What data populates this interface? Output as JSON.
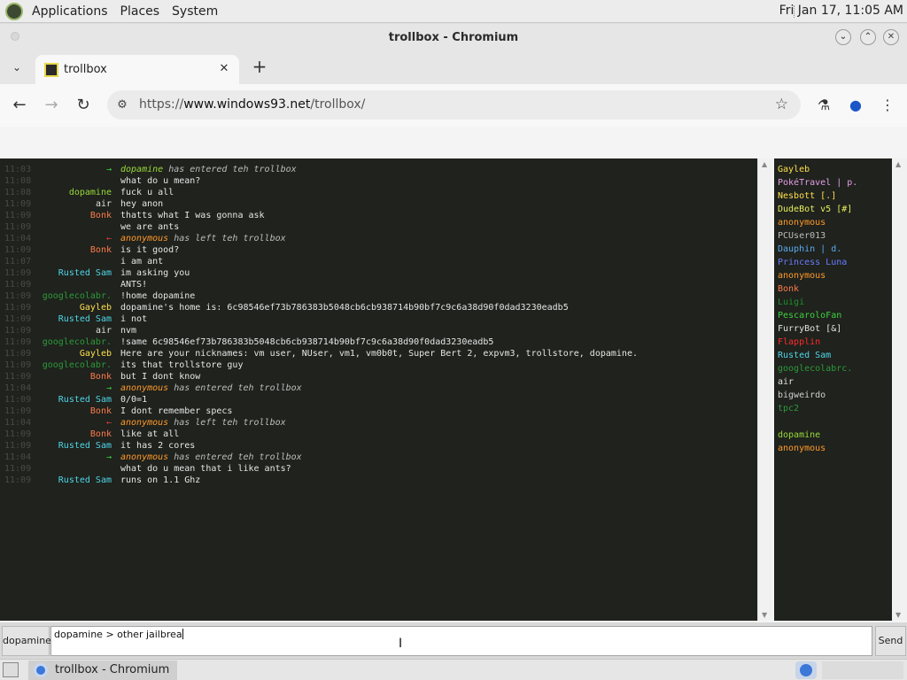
{
  "panel": {
    "applications": "Applications",
    "places": "Places",
    "system": "System",
    "clock": "Fri Jan 17, 11:05 AM"
  },
  "window": {
    "title": "trollbox - Chromium"
  },
  "tab": {
    "label": "trollbox"
  },
  "toolbar": {
    "url_scheme": "https://",
    "url_host": "www.windows93.net",
    "url_path": "/trollbox/"
  },
  "chat": {
    "messages": [
      {
        "time": "11:03",
        "nick": "→",
        "nick_color": "#3ed13e",
        "who": "dopamine",
        "who_color": "#9ad93a",
        "text": " has entered teh trollbox",
        "system": true
      },
      {
        "time": "11:08",
        "nick": "",
        "nick_color": "#ffffff",
        "who": "",
        "who_color": "",
        "text": "what do u mean?",
        "system": false
      },
      {
        "time": "11:08",
        "nick": "dopamine",
        "nick_color": "#9ad93a",
        "who": "",
        "who_color": "",
        "text": "fuck u all",
        "system": false
      },
      {
        "time": "11:09",
        "nick": "air",
        "nick_color": "#e0e0e0",
        "who": "",
        "who_color": "",
        "text": "hey anon",
        "system": false
      },
      {
        "time": "11:09",
        "nick": "Bonk",
        "nick_color": "#ff7b4a",
        "who": "",
        "who_color": "",
        "text": "thatts what I was gonna ask",
        "system": false
      },
      {
        "time": "11:09",
        "nick": "",
        "nick_color": "#ffffff",
        "who": "",
        "who_color": "",
        "text": "we are ants",
        "system": false
      },
      {
        "time": "11:04",
        "nick": "←",
        "nick_color": "#e23b3b",
        "who": "anonymous",
        "who_color": "#ff9a2a",
        "text": " has left teh trollbox",
        "system": true
      },
      {
        "time": "11:09",
        "nick": "Bonk",
        "nick_color": "#ff7b4a",
        "who": "",
        "who_color": "",
        "text": "is it good?",
        "system": false
      },
      {
        "time": "11:07",
        "nick": "",
        "nick_color": "#ffffff",
        "who": "",
        "who_color": "",
        "text": "i am ant",
        "system": false
      },
      {
        "time": "11:09",
        "nick": "Rusted Sam",
        "nick_color": "#4fd6e8",
        "who": "",
        "who_color": "",
        "text": "im asking you",
        "system": false
      },
      {
        "time": "11:09",
        "nick": "",
        "nick_color": "#ffffff",
        "who": "",
        "who_color": "",
        "text": "ANTS!",
        "system": false
      },
      {
        "time": "11:09",
        "nick": "googlecolabr.",
        "nick_color": "#2d9a3a",
        "who": "",
        "who_color": "",
        "text": "!home dopamine",
        "system": false
      },
      {
        "time": "11:09",
        "nick": "Gayleb",
        "nick_color": "#ffe04a",
        "who": "",
        "who_color": "",
        "text": "dopamine's home is: 6c98546ef73b786383b5048cb6cb938714b90bf7c9c6a38d90f0dad3230eadb5",
        "system": false
      },
      {
        "time": "11:09",
        "nick": "Rusted Sam",
        "nick_color": "#4fd6e8",
        "who": "",
        "who_color": "",
        "text": "i not",
        "system": false
      },
      {
        "time": "11:09",
        "nick": "air",
        "nick_color": "#e0e0e0",
        "who": "",
        "who_color": "",
        "text": "nvm",
        "system": false
      },
      {
        "time": "11:09",
        "nick": "googlecolabr.",
        "nick_color": "#2d9a3a",
        "who": "",
        "who_color": "",
        "text": "!same 6c98546ef73b786383b5048cb6cb938714b90bf7c9c6a38d90f0dad3230eadb5",
        "system": false
      },
      {
        "time": "11:09",
        "nick": "Gayleb",
        "nick_color": "#ffe04a",
        "who": "",
        "who_color": "",
        "text": "Here are your nicknames: vm user, NUser, vm1, vm0b0t, Super Bert 2, expvm3, trollstore, dopamine.",
        "system": false
      },
      {
        "time": "11:09",
        "nick": "googlecolabr.",
        "nick_color": "#2d9a3a",
        "who": "",
        "who_color": "",
        "text": "its that trollstore guy",
        "system": false
      },
      {
        "time": "11:09",
        "nick": "Bonk",
        "nick_color": "#ff7b4a",
        "who": "",
        "who_color": "",
        "text": "but I dont know",
        "system": false
      },
      {
        "time": "11:04",
        "nick": "→",
        "nick_color": "#3ed13e",
        "who": "anonymous",
        "who_color": "#ff9a2a",
        "text": " has entered teh trollbox",
        "system": true
      },
      {
        "time": "11:09",
        "nick": "Rusted Sam",
        "nick_color": "#4fd6e8",
        "who": "",
        "who_color": "",
        "text": "0/0=1",
        "system": false
      },
      {
        "time": "11:09",
        "nick": "Bonk",
        "nick_color": "#ff7b4a",
        "who": "",
        "who_color": "",
        "text": "I dont remember specs",
        "system": false
      },
      {
        "time": "11:04",
        "nick": "←",
        "nick_color": "#e23b3b",
        "who": "anonymous",
        "who_color": "#ff9a2a",
        "text": " has left teh trollbox",
        "system": true
      },
      {
        "time": "11:09",
        "nick": "Bonk",
        "nick_color": "#ff7b4a",
        "who": "",
        "who_color": "",
        "text": "like at all",
        "system": false
      },
      {
        "time": "11:09",
        "nick": "Rusted Sam",
        "nick_color": "#4fd6e8",
        "who": "",
        "who_color": "",
        "text": "it has 2 cores",
        "system": false
      },
      {
        "time": "11:04",
        "nick": "→",
        "nick_color": "#3ed13e",
        "who": "anonymous",
        "who_color": "#ff9a2a",
        "text": " has entered teh trollbox",
        "system": true
      },
      {
        "time": "11:09",
        "nick": "",
        "nick_color": "#ffffff",
        "who": "",
        "who_color": "",
        "text": "what do u mean that i like ants?",
        "system": false
      },
      {
        "time": "11:09",
        "nick": "Rusted Sam",
        "nick_color": "#4fd6e8",
        "who": "",
        "who_color": "",
        "text": "runs on 1.1 Ghz",
        "system": false
      }
    ]
  },
  "users": [
    {
      "name": "Gayleb",
      "color": "#ffe04a"
    },
    {
      "name": "PokéTravel | p.",
      "color": "#e79ee8"
    },
    {
      "name": "Nesbott [.]",
      "color": "#ffe04a"
    },
    {
      "name": "DudeBot v5 [#]",
      "color": "#e8ef5a"
    },
    {
      "name": "anonymous",
      "color": "#ff9a2a"
    },
    {
      "name": "PCUser013",
      "color": "#bdbdbd"
    },
    {
      "name": "Dauphin | d.",
      "color": "#5aaaf0"
    },
    {
      "name": "Princess Luna",
      "color": "#6a7cff"
    },
    {
      "name": "anonymous",
      "color": "#ff9a2a"
    },
    {
      "name": "Bonk",
      "color": "#ff7b4a"
    },
    {
      "name": "Luigi",
      "color": "#1f8f2a"
    },
    {
      "name": "PescaroloFan",
      "color": "#3ed13e"
    },
    {
      "name": "FurryBot [&]",
      "color": "#e0e0e0"
    },
    {
      "name": "Flapplin",
      "color": "#ff2a2a"
    },
    {
      "name": "Rusted Sam",
      "color": "#4fd6e8"
    },
    {
      "name": "googlecolabrc.",
      "color": "#2d9a3a"
    },
    {
      "name": "air",
      "color": "#e0e0e0"
    },
    {
      "name": "bigweirdo",
      "color": "#d0d0d0"
    },
    {
      "name": "tpc2",
      "color": "#2d9a3a"
    },
    {
      "name": "",
      "color": "#e0e0e0"
    },
    {
      "name": "dopamine",
      "color": "#9ad93a"
    },
    {
      "name": "anonymous",
      "color": "#ff9a2a"
    }
  ],
  "input": {
    "nick_button": "dopamine",
    "value": "dopamine > other jailbrea",
    "send_label": "Send"
  },
  "taskbar": {
    "window_label": "trollbox - Chromium"
  }
}
